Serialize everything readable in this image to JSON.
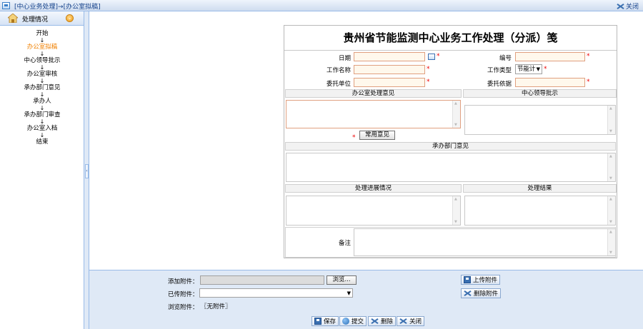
{
  "window": {
    "breadcrumb": "[中心业务处理]→[办公室拟稿]",
    "close_label": "关闭"
  },
  "sidebar": {
    "title": "处理情况",
    "steps": [
      {
        "label": "开始",
        "active": false
      },
      {
        "label": "办公室拟稿",
        "active": true
      },
      {
        "label": "中心领导批示",
        "active": false
      },
      {
        "label": "办公室审核",
        "active": false
      },
      {
        "label": "承办部门意见",
        "active": false
      },
      {
        "label": "承办人",
        "active": false
      },
      {
        "label": "承办部门审查",
        "active": false
      },
      {
        "label": "办公室入档",
        "active": false
      },
      {
        "label": "结束",
        "active": false
      }
    ],
    "arrow": "↓"
  },
  "form": {
    "title": "贵州省节能监测中心业务工作处理（分派）笺",
    "fields": {
      "date_label": "日期",
      "number_label": "编号",
      "work_name_label": "工作名称",
      "work_type_label": "工作类型",
      "work_type_value": "节能计",
      "entrust_unit_label": "委托单位",
      "entrust_basis_label": "委托依据"
    },
    "required_mark": "*",
    "sections": {
      "office_opinion": "办公室处理意见",
      "leader_instruction": "中心领导批示",
      "dept_opinion": "承办部门意见",
      "progress": "处理进展情况",
      "result": "处理结果",
      "remarks": "备注"
    },
    "common_opinion_button": "常用意见"
  },
  "attachments": {
    "add_label": "添加附件：",
    "browse_button": "浏览...",
    "uploaded_label": "已传附件：",
    "view_label": "浏览附件：",
    "view_value": "〖无附件〗",
    "upload_button": "上传附件",
    "delete_attachment_button": "删除附件"
  },
  "actions": {
    "save": "保存",
    "submit": "提交",
    "delete": "删除",
    "close": "关闭"
  }
}
